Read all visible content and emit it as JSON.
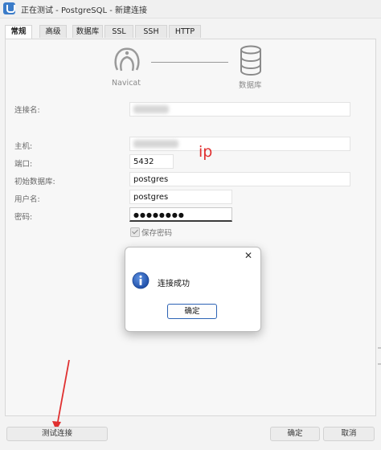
{
  "window": {
    "title": "正在测试 - PostgreSQL - 新建连接"
  },
  "tabs": [
    {
      "label": "常规",
      "active": true
    },
    {
      "label": "高级",
      "active": false
    },
    {
      "label": "数据库",
      "active": false
    },
    {
      "label": "SSL",
      "active": false
    },
    {
      "label": "SSH",
      "active": false
    },
    {
      "label": "HTTP",
      "active": false
    }
  ],
  "diagram": {
    "left_caption": "Navicat",
    "right_caption": "数据库"
  },
  "form": {
    "connection_name_label": "连接名:",
    "host_label": "主机:",
    "port_label": "端口:",
    "port_value": "5432",
    "initial_db_label": "初始数据库:",
    "initial_db_value": "postgres",
    "username_label": "用户名:",
    "username_value": "postgres",
    "password_label": "密码:",
    "password_value": "●●●●●●●●",
    "save_password_label": "保存密码"
  },
  "annotation": {
    "text": "ip",
    "color": "#e03030"
  },
  "dialog": {
    "message": "连接成功",
    "ok_label": "确定"
  },
  "footer": {
    "test_button": "测试连接",
    "ok_button": "确定",
    "cancel_button": "取消"
  },
  "colors": {
    "accent": "#2b62b4",
    "annotation_red": "#e03030"
  }
}
